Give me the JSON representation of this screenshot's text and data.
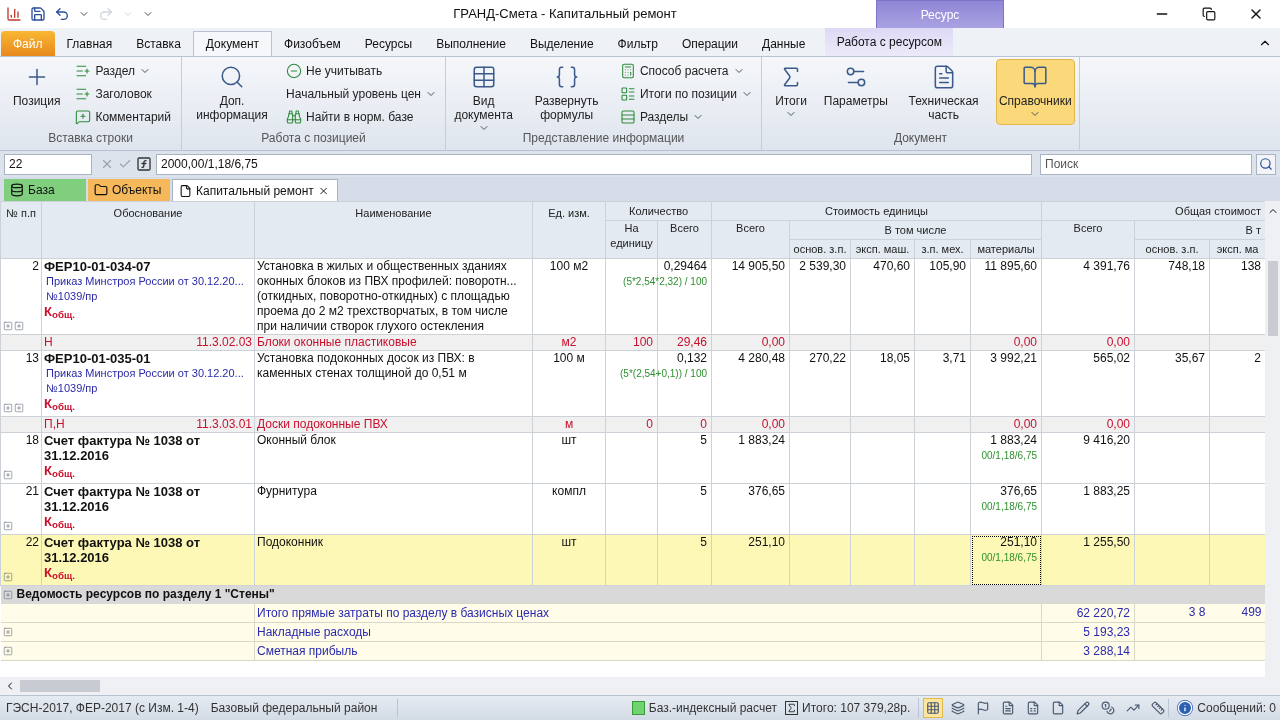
{
  "window": {
    "title": "ГРАНД-Смета - Капитальный ремонт",
    "context_label": "Ресурс"
  },
  "ribbon_tabs": [
    {
      "label": "Файл",
      "kind": "file",
      "selected": false
    },
    {
      "label": "Главная",
      "kind": "tab",
      "selected": false
    },
    {
      "label": "Вставка",
      "kind": "tab",
      "selected": false
    },
    {
      "label": "Документ",
      "kind": "tab",
      "selected": true
    },
    {
      "label": "Физобъем",
      "kind": "tab",
      "selected": false
    },
    {
      "label": "Ресурсы",
      "kind": "tab",
      "selected": false
    },
    {
      "label": "Выполнение",
      "kind": "tab",
      "selected": false
    },
    {
      "label": "Выделение",
      "kind": "tab",
      "selected": false
    },
    {
      "label": "Фильтр",
      "kind": "tab",
      "selected": false
    },
    {
      "label": "Операции",
      "kind": "tab",
      "selected": false
    },
    {
      "label": "Данные",
      "kind": "tab",
      "selected": false
    },
    {
      "label": "Работа с ресурсом",
      "kind": "context",
      "selected": false
    }
  ],
  "ribbon_groups": [
    {
      "title": "Вставка строки",
      "buttons": [
        {
          "label": "Позиция",
          "kind": "large",
          "dropdown": false,
          "selected": false
        },
        {
          "label": "Раздел",
          "kind": "small",
          "dropdown": true,
          "selected": false
        },
        {
          "label": "Заголовок",
          "kind": "small",
          "dropdown": false,
          "selected": false
        },
        {
          "label": "Комментарий",
          "kind": "small",
          "dropdown": false,
          "selected": false
        }
      ]
    },
    {
      "title": "Работа с позицией",
      "buttons": [
        {
          "label": "Доп. информация",
          "kind": "large",
          "dropdown": false,
          "selected": false
        },
        {
          "label": "Не учитывать",
          "kind": "small",
          "dropdown": false,
          "selected": false
        },
        {
          "label": "Начальный уровень цен",
          "kind": "small",
          "dropdown": true,
          "selected": false
        },
        {
          "label": "Найти в норм. базе",
          "kind": "small",
          "dropdown": false,
          "selected": false
        }
      ]
    },
    {
      "title": "Представление информации",
      "buttons": [
        {
          "label": "Вид документа",
          "kind": "large",
          "dropdown": true,
          "selected": false
        },
        {
          "label": "Развернуть формулы",
          "kind": "large",
          "dropdown": false,
          "selected": false
        },
        {
          "label": "Способ расчета",
          "kind": "small",
          "dropdown": true,
          "selected": false
        },
        {
          "label": "Итоги по позиции",
          "kind": "small",
          "dropdown": true,
          "selected": false
        },
        {
          "label": "Разделы",
          "kind": "small",
          "dropdown": true,
          "selected": false
        }
      ]
    },
    {
      "title": "Документ",
      "buttons": [
        {
          "label": "Итоги",
          "kind": "large",
          "dropdown": true,
          "selected": false
        },
        {
          "label": "Параметры",
          "kind": "large",
          "dropdown": false,
          "selected": false
        },
        {
          "label": "Техническая часть",
          "kind": "large",
          "dropdown": false,
          "selected": false
        },
        {
          "label": "Справочники",
          "kind": "large",
          "dropdown": true,
          "selected": true
        }
      ]
    }
  ],
  "formula_bar": {
    "cell": "22",
    "formula": "2000,00/1,18/6,75",
    "search_placeholder": "Поиск"
  },
  "doc_tabs": [
    {
      "label": "База",
      "color": "#7fcf7f",
      "selected": false,
      "closable": false
    },
    {
      "label": "Объекты",
      "color": "#f5b85a",
      "selected": false,
      "closable": false
    },
    {
      "label": "Капитальный ремонт",
      "color": "#ffffff",
      "selected": true,
      "closable": true
    }
  ],
  "header": {
    "number": "№ п.п",
    "basis": "Обоснование",
    "name": "Наименование",
    "unit": "Ед. изм.",
    "quantity": {
      "title": "Количество",
      "per_unit": "На единицу",
      "total": "Всего"
    },
    "unit_cost": {
      "title": "Стоимость единицы",
      "total": "Всего",
      "including": "В том числе",
      "sub": [
        "основ. з.п.",
        "эксп. маш.",
        "з.п. мех.",
        "материалы"
      ]
    },
    "total_cost": {
      "title": "Общая стоимост",
      "total": "Всего",
      "including": "В т",
      "sub": [
        "основ. з.п.",
        "эксп. ма"
      ]
    }
  },
  "rows": [
    {
      "kind": "position",
      "number": "2",
      "code": "ФЕР10-01-034-07",
      "order_lines": [
        "Приказ Минстроя России от 30.12.20...",
        "№1039/пр"
      ],
      "k": "К$_{общ.}$",
      "name": "Установка в жилых и общественных зданиях оконных блоков из ПВХ профилей: поворотн... (откидных, поворотно-откидных) с площадью проема до 2 м2 трехстворчатых, в том числе при наличии створок глухого остекления",
      "unit": "100 м2",
      "qty": "0,29464",
      "qty_formula": "(5*2,54*2,32) / 100",
      "unit_total": "14 905,50",
      "zp": "2 539,30",
      "mash": "470,60",
      "mech": "105,90",
      "materials": "11 895,60",
      "total": "4 391,76",
      "total_zp": "748,18",
      "total_mash": "138",
      "selected": false
    },
    {
      "kind": "resource",
      "type": "Н",
      "code": "11.3.02.03",
      "name": "Блоки оконные пластиковые",
      "unit": "м2",
      "per_unit": "100",
      "qty": "29,46",
      "unit_total": "0,00",
      "materials": "0,00",
      "total": "0,00"
    },
    {
      "kind": "position",
      "number": "13",
      "code": "ФЕР10-01-035-01",
      "order_lines": [
        "Приказ Минстроя России от 30.12.20...",
        "№1039/пр"
      ],
      "k": "К$_{общ.}$",
      "name": "Установка подоконных досок из ПВХ: в каменных стенах толщиной до 0,51 м",
      "unit": "100 м",
      "qty": "0,132",
      "qty_formula": "(5*(2,54+0,1)) / 100",
      "unit_total": "4 280,48",
      "zp": "270,22",
      "mash": "18,05",
      "mech": "3,71",
      "materials": "3 992,21",
      "total": "565,02",
      "total_zp": "35,67",
      "total_mash": "2",
      "selected": false
    },
    {
      "kind": "resource",
      "type": "П,Н",
      "code": "11.3.03.01",
      "name": "Доски подоконные ПВХ",
      "unit": "м",
      "per_unit": "0",
      "qty": "0",
      "unit_total": "0,00",
      "materials": "0,00",
      "total": "0,00"
    },
    {
      "kind": "invoice",
      "number": "18",
      "code": "Счет фактура № 1038 от 31.12.2016",
      "k": "К$_{общ.}$",
      "name": "Оконный блок",
      "unit": "шт",
      "qty": "5",
      "unit_total": "1 883,24",
      "materials": "1 883,24",
      "materials_formula": "00/1,18/6,75",
      "total": "9 416,20",
      "selected": false
    },
    {
      "kind": "invoice",
      "number": "21",
      "code": "Счет фактура № 1038 от 31.12.2016",
      "k": "К$_{общ.}$",
      "name": "Фурнитура",
      "unit": "компл",
      "qty": "5",
      "unit_total": "376,65",
      "materials": "376,65",
      "materials_formula": "00/1,18/6,75",
      "total": "1 883,25",
      "selected": false
    },
    {
      "kind": "invoice",
      "number": "22",
      "code": "Счет фактура № 1038 от 31.12.2016",
      "k": "К$_{общ.}$",
      "name": "Подоконник",
      "unit": "шт",
      "qty": "5",
      "unit_total": "251,10",
      "materials": "251,10",
      "materials_formula": "00/1,18/6,75",
      "total": "1 255,50",
      "selected": true
    },
    {
      "kind": "section",
      "label": "Ведомость ресурсов по разделу 1 \"Стены\""
    },
    {
      "kind": "summary",
      "expandable": false,
      "label": "Итого прямые затраты по разделу в базисных ценах",
      "total": "62 220,72",
      "total_zp": "3 8",
      "total_mash": "499"
    },
    {
      "kind": "summary",
      "expandable": true,
      "label": "Накладные расходы",
      "total": "5 193,23"
    },
    {
      "kind": "summary",
      "expandable": true,
      "label": "Сметная прибыль",
      "total": "3 288,14"
    }
  ],
  "status_bar": {
    "norm_base": "ГЭСН-2017, ФЕР-2017 (с Изм. 1-4)",
    "region": "Базовый федеральный район",
    "calc_method": "Баз.-индексный расчет",
    "total": "Итого: 107 379,28р.",
    "tools": [
      {
        "selected": true
      },
      {
        "selected": false
      },
      {
        "selected": false
      },
      {
        "selected": false
      },
      {
        "selected": false
      },
      {
        "selected": false
      },
      {
        "selected": false
      },
      {
        "selected": false
      },
      {
        "selected": false
      },
      {
        "selected": false
      }
    ],
    "messages": "Сообщений: 0"
  }
}
